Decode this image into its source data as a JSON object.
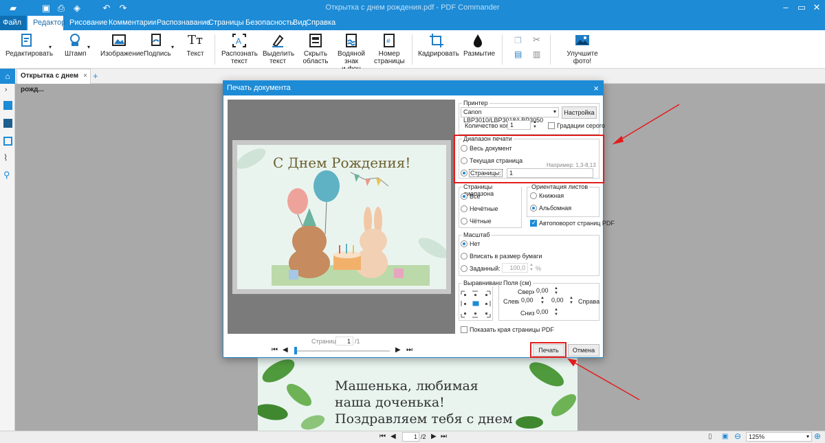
{
  "window": {
    "title": "Открытка с днем рождения.pdf - PDF Commander"
  },
  "menu": {
    "file": "Файл",
    "tabs": [
      "Редактор",
      "Рисование",
      "Комментарии",
      "Распознавание",
      "Страницы",
      "Безопасность",
      "Вид",
      "Справка"
    ]
  },
  "ribbon": {
    "edit": "Редактировать",
    "stamp": "Штамп",
    "image": "Изображение",
    "sign": "Подпись",
    "text": "Текст",
    "recognize1": "Распознать",
    "recognize2": "текст",
    "select1": "Выделить",
    "select2": "текст",
    "hide1": "Скрыть",
    "hide2": "область",
    "watermark1": "Водяной знак",
    "watermark2": "и фон",
    "pagenum1": "Номер",
    "pagenum2": "страницы",
    "crop": "Кадрировать",
    "blur": "Размытие",
    "enhance": "Улучшите фото!"
  },
  "document_tab": {
    "label": "Открытка с днем рожд...",
    "close": "×",
    "add": "+"
  },
  "background_card": {
    "line1": "Машенька, любимая",
    "line2": "наша доченька!",
    "line3": "Поздравляем тебя с днем"
  },
  "dialog": {
    "title": "Печать документа",
    "close": "×",
    "preview_card_title": "С Днем Рождения!",
    "page_label": "Страница:",
    "page_current": "1",
    "page_total": "/1",
    "printer": {
      "group": "Принтер",
      "selected": "Canon LBP3010/LBP3018/LBP3050",
      "settings_button": "Настройка",
      "copies_label": "Количество копий",
      "copies_value": "1",
      "grayscale_label": "Градации серого"
    },
    "range": {
      "group": "Диапазон печати",
      "all": "Весь документ",
      "current": "Текущая страница",
      "pages": "Страницы:",
      "pages_value": "1",
      "example": "Например: 1,3-8,13"
    },
    "subset": {
      "group": "Страницы диапазона",
      "all": "Все",
      "odd": "Нечётные",
      "even": "Чётные"
    },
    "orientation": {
      "group": "Ориентация листов",
      "portrait": "Книжная",
      "landscape": "Альбомная",
      "autorotate": "Автоповорот страниц PDF"
    },
    "scale": {
      "group": "Масштаб",
      "none": "Нет",
      "fit": "Вписать в размер бумаги",
      "custom": "Заданный:",
      "custom_value": "100,0",
      "percent": "%"
    },
    "align": {
      "group": "Выравнивание"
    },
    "margins": {
      "group": "Поля (см)",
      "top_label": "Сверху",
      "top_value": "0,00",
      "left_label": "Слева",
      "left_value": "0,00",
      "right_value": "0,00",
      "right_label": "Справа",
      "bottom_label": "Снизу",
      "bottom_value": "0,00"
    },
    "show_edges": "Показать края страницы PDF",
    "print_button": "Печать",
    "cancel_button": "Отмена"
  },
  "status": {
    "page_current": "1",
    "page_total": "/2",
    "zoom": "125%"
  },
  "colors": {
    "accent": "#1d8bd6",
    "highlight": "#e21b1b"
  }
}
